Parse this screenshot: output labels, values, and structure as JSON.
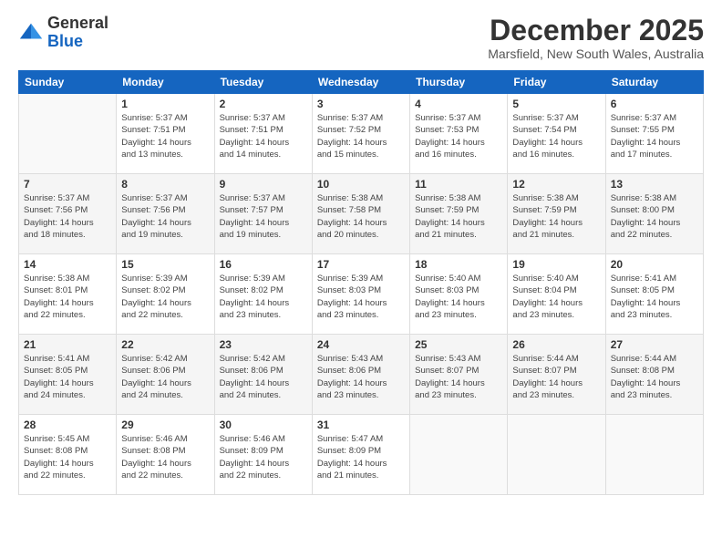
{
  "logo": {
    "general": "General",
    "blue": "Blue"
  },
  "title": "December 2025",
  "subtitle": "Marsfield, New South Wales, Australia",
  "days_of_week": [
    "Sunday",
    "Monday",
    "Tuesday",
    "Wednesday",
    "Thursday",
    "Friday",
    "Saturday"
  ],
  "weeks": [
    {
      "shaded": false,
      "days": [
        {
          "num": "",
          "sunrise": "",
          "sunset": "",
          "daylight": ""
        },
        {
          "num": "1",
          "sunrise": "Sunrise: 5:37 AM",
          "sunset": "Sunset: 7:51 PM",
          "daylight": "Daylight: 14 hours and 13 minutes."
        },
        {
          "num": "2",
          "sunrise": "Sunrise: 5:37 AM",
          "sunset": "Sunset: 7:51 PM",
          "daylight": "Daylight: 14 hours and 14 minutes."
        },
        {
          "num": "3",
          "sunrise": "Sunrise: 5:37 AM",
          "sunset": "Sunset: 7:52 PM",
          "daylight": "Daylight: 14 hours and 15 minutes."
        },
        {
          "num": "4",
          "sunrise": "Sunrise: 5:37 AM",
          "sunset": "Sunset: 7:53 PM",
          "daylight": "Daylight: 14 hours and 16 minutes."
        },
        {
          "num": "5",
          "sunrise": "Sunrise: 5:37 AM",
          "sunset": "Sunset: 7:54 PM",
          "daylight": "Daylight: 14 hours and 16 minutes."
        },
        {
          "num": "6",
          "sunrise": "Sunrise: 5:37 AM",
          "sunset": "Sunset: 7:55 PM",
          "daylight": "Daylight: 14 hours and 17 minutes."
        }
      ]
    },
    {
      "shaded": true,
      "days": [
        {
          "num": "7",
          "sunrise": "Sunrise: 5:37 AM",
          "sunset": "Sunset: 7:56 PM",
          "daylight": "Daylight: 14 hours and 18 minutes."
        },
        {
          "num": "8",
          "sunrise": "Sunrise: 5:37 AM",
          "sunset": "Sunset: 7:56 PM",
          "daylight": "Daylight: 14 hours and 19 minutes."
        },
        {
          "num": "9",
          "sunrise": "Sunrise: 5:37 AM",
          "sunset": "Sunset: 7:57 PM",
          "daylight": "Daylight: 14 hours and 19 minutes."
        },
        {
          "num": "10",
          "sunrise": "Sunrise: 5:38 AM",
          "sunset": "Sunset: 7:58 PM",
          "daylight": "Daylight: 14 hours and 20 minutes."
        },
        {
          "num": "11",
          "sunrise": "Sunrise: 5:38 AM",
          "sunset": "Sunset: 7:59 PM",
          "daylight": "Daylight: 14 hours and 21 minutes."
        },
        {
          "num": "12",
          "sunrise": "Sunrise: 5:38 AM",
          "sunset": "Sunset: 7:59 PM",
          "daylight": "Daylight: 14 hours and 21 minutes."
        },
        {
          "num": "13",
          "sunrise": "Sunrise: 5:38 AM",
          "sunset": "Sunset: 8:00 PM",
          "daylight": "Daylight: 14 hours and 22 minutes."
        }
      ]
    },
    {
      "shaded": false,
      "days": [
        {
          "num": "14",
          "sunrise": "Sunrise: 5:38 AM",
          "sunset": "Sunset: 8:01 PM",
          "daylight": "Daylight: 14 hours and 22 minutes."
        },
        {
          "num": "15",
          "sunrise": "Sunrise: 5:39 AM",
          "sunset": "Sunset: 8:02 PM",
          "daylight": "Daylight: 14 hours and 22 minutes."
        },
        {
          "num": "16",
          "sunrise": "Sunrise: 5:39 AM",
          "sunset": "Sunset: 8:02 PM",
          "daylight": "Daylight: 14 hours and 23 minutes."
        },
        {
          "num": "17",
          "sunrise": "Sunrise: 5:39 AM",
          "sunset": "Sunset: 8:03 PM",
          "daylight": "Daylight: 14 hours and 23 minutes."
        },
        {
          "num": "18",
          "sunrise": "Sunrise: 5:40 AM",
          "sunset": "Sunset: 8:03 PM",
          "daylight": "Daylight: 14 hours and 23 minutes."
        },
        {
          "num": "19",
          "sunrise": "Sunrise: 5:40 AM",
          "sunset": "Sunset: 8:04 PM",
          "daylight": "Daylight: 14 hours and 23 minutes."
        },
        {
          "num": "20",
          "sunrise": "Sunrise: 5:41 AM",
          "sunset": "Sunset: 8:05 PM",
          "daylight": "Daylight: 14 hours and 23 minutes."
        }
      ]
    },
    {
      "shaded": true,
      "days": [
        {
          "num": "21",
          "sunrise": "Sunrise: 5:41 AM",
          "sunset": "Sunset: 8:05 PM",
          "daylight": "Daylight: 14 hours and 24 minutes."
        },
        {
          "num": "22",
          "sunrise": "Sunrise: 5:42 AM",
          "sunset": "Sunset: 8:06 PM",
          "daylight": "Daylight: 14 hours and 24 minutes."
        },
        {
          "num": "23",
          "sunrise": "Sunrise: 5:42 AM",
          "sunset": "Sunset: 8:06 PM",
          "daylight": "Daylight: 14 hours and 24 minutes."
        },
        {
          "num": "24",
          "sunrise": "Sunrise: 5:43 AM",
          "sunset": "Sunset: 8:06 PM",
          "daylight": "Daylight: 14 hours and 23 minutes."
        },
        {
          "num": "25",
          "sunrise": "Sunrise: 5:43 AM",
          "sunset": "Sunset: 8:07 PM",
          "daylight": "Daylight: 14 hours and 23 minutes."
        },
        {
          "num": "26",
          "sunrise": "Sunrise: 5:44 AM",
          "sunset": "Sunset: 8:07 PM",
          "daylight": "Daylight: 14 hours and 23 minutes."
        },
        {
          "num": "27",
          "sunrise": "Sunrise: 5:44 AM",
          "sunset": "Sunset: 8:08 PM",
          "daylight": "Daylight: 14 hours and 23 minutes."
        }
      ]
    },
    {
      "shaded": false,
      "days": [
        {
          "num": "28",
          "sunrise": "Sunrise: 5:45 AM",
          "sunset": "Sunset: 8:08 PM",
          "daylight": "Daylight: 14 hours and 22 minutes."
        },
        {
          "num": "29",
          "sunrise": "Sunrise: 5:46 AM",
          "sunset": "Sunset: 8:08 PM",
          "daylight": "Daylight: 14 hours and 22 minutes."
        },
        {
          "num": "30",
          "sunrise": "Sunrise: 5:46 AM",
          "sunset": "Sunset: 8:09 PM",
          "daylight": "Daylight: 14 hours and 22 minutes."
        },
        {
          "num": "31",
          "sunrise": "Sunrise: 5:47 AM",
          "sunset": "Sunset: 8:09 PM",
          "daylight": "Daylight: 14 hours and 21 minutes."
        },
        {
          "num": "",
          "sunrise": "",
          "sunset": "",
          "daylight": ""
        },
        {
          "num": "",
          "sunrise": "",
          "sunset": "",
          "daylight": ""
        },
        {
          "num": "",
          "sunrise": "",
          "sunset": "",
          "daylight": ""
        }
      ]
    }
  ]
}
